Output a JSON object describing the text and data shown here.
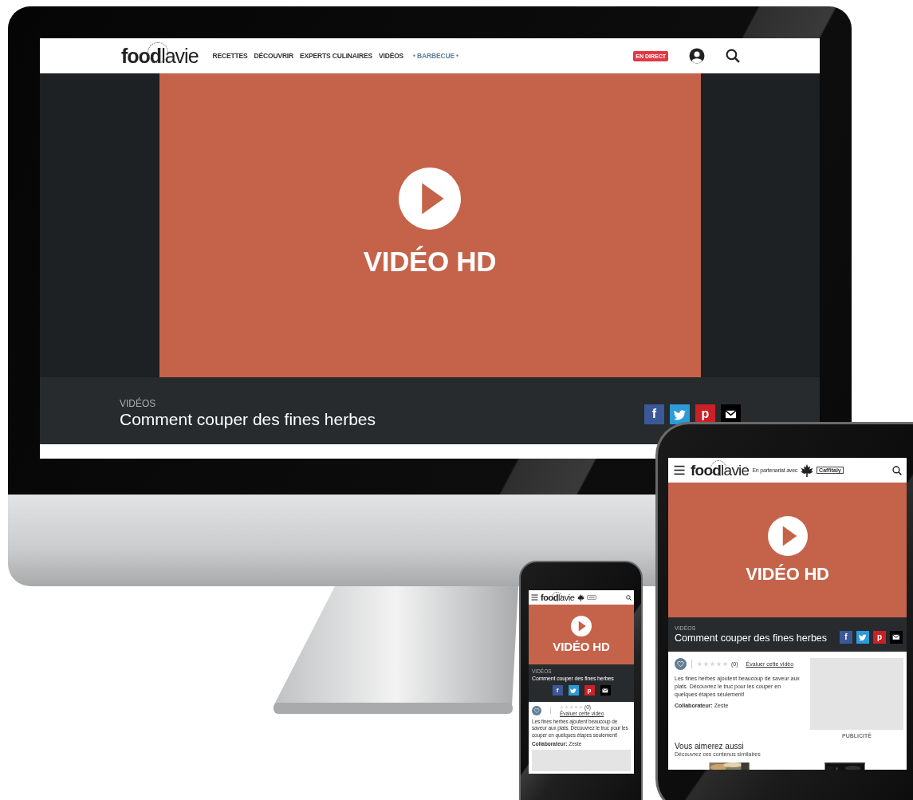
{
  "desktop": {
    "logo": "**food**lavie",
    "nav": [
      {
        "label": "RECETTES",
        "kind": "link"
      },
      {
        "label": "DÉCOUVRIR",
        "kind": "link"
      },
      {
        "label": "EXPERTS CULINAIRES",
        "kind": "link"
      },
      {
        "label": "VIDÉOS",
        "kind": "link"
      },
      {
        "label": "• BARBECUE •",
        "kind": "highlight"
      }
    ],
    "live_badge": "EN DIRECT",
    "video_label": "VIDÉO HD",
    "category": "VIDÉOS",
    "title": "Comment couper des fines herbes",
    "share": [
      {
        "kind": "facebook",
        "glyph": "f",
        "color": "#3b5998"
      },
      {
        "kind": "twitter",
        "color": "#2d9ad9"
      },
      {
        "kind": "pinterest",
        "glyph": "p",
        "color": "#cb2027"
      },
      {
        "kind": "email",
        "color": "#000000"
      }
    ]
  },
  "tablet": {
    "logo": "**food**lavie",
    "partner_text": "En partenariat avec",
    "partner_brand": "Caffitaly",
    "video_label": "VIDÉO HD",
    "category": "VIDÉOS",
    "title": "Comment couper des fines herbes",
    "share": [
      {
        "kind": "facebook",
        "glyph": "f",
        "color": "#3b5998"
      },
      {
        "kind": "twitter",
        "color": "#2d9ad9"
      },
      {
        "kind": "pinterest",
        "glyph": "p",
        "color": "#cb2027"
      },
      {
        "kind": "email",
        "color": "#000000"
      }
    ],
    "rating": {
      "stars": 0,
      "count": "(0)",
      "link": "Évaluer cette vidéo"
    },
    "description": "Les fines herbes ajoutent beaucoup de saveur aux plats. Découvrez le truc pour les couper en quelques étapes seulement!",
    "contributor": "**Collaborateur:** Zeste",
    "ad_label": "PUBLICITÉ",
    "related": {
      "title": "Vous aimerez aussi",
      "subtitle": "Découvrez ces contenus similaires"
    }
  },
  "phone": {
    "logo": "**food**lavie",
    "video_label": "VIDÉO HD",
    "category": "VIDÉOS",
    "title": "Comment couper des fines herbes",
    "share": [
      {
        "kind": "facebook",
        "glyph": "f",
        "color": "#3b5998"
      },
      {
        "kind": "twitter",
        "color": "#2d9ad9"
      },
      {
        "kind": "pinterest",
        "glyph": "p",
        "color": "#cb2027"
      },
      {
        "kind": "email",
        "color": "#000000"
      }
    ],
    "rating": {
      "stars": 0,
      "count": "(0)",
      "link": "Évaluer cette vidéo"
    },
    "description": "Les fines herbes ajoutent beaucoup de saveur aux plats. Découvrez le truc pour les couper en quelques étapes seulement!",
    "contributor": "**Collaborateur:** Zeste"
  }
}
